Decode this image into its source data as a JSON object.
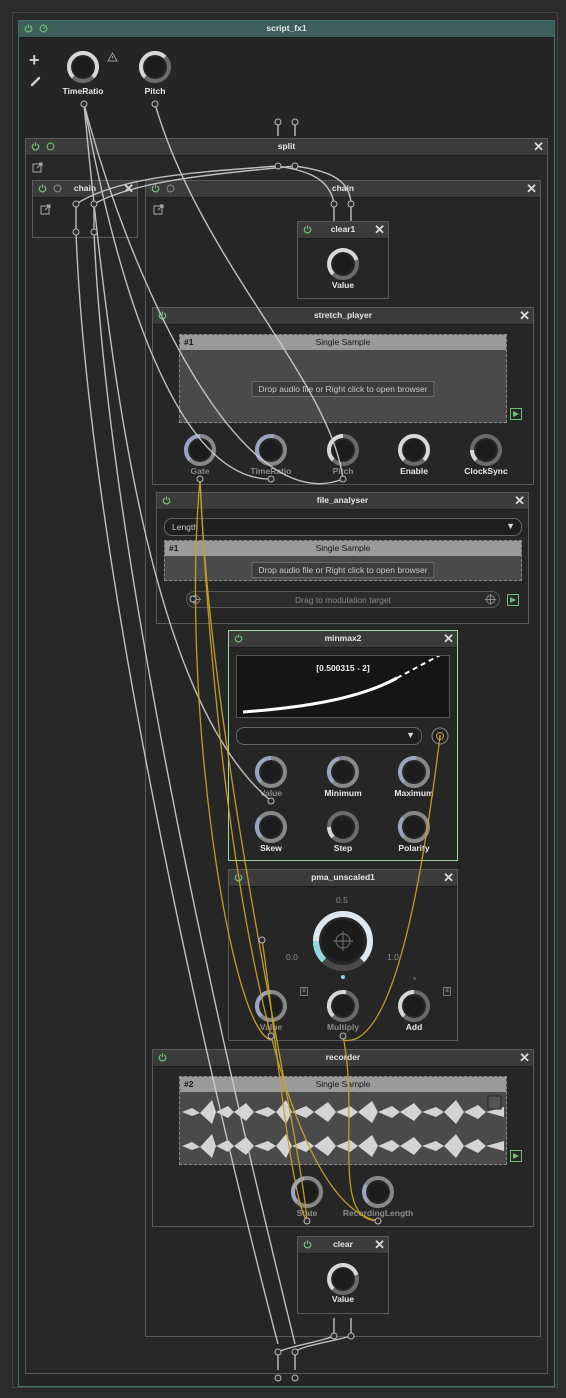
{
  "script_fx": {
    "title": "script_fx1",
    "knobs": [
      {
        "label": "TimeRatio"
      },
      {
        "label": "Pitch"
      }
    ]
  },
  "split": {
    "title": "split"
  },
  "chain_left": {
    "title": "chain"
  },
  "chain_main": {
    "title": "chain"
  },
  "clear1": {
    "title": "clear1",
    "knob_label": "Value"
  },
  "stretch_player": {
    "title": "stretch_player",
    "sample_index": "#1",
    "sample_title": "Single Sample",
    "drop_text": "Drop audio file or Right click to open browser",
    "knobs": [
      {
        "label": "Gate"
      },
      {
        "label": "TimeRatio"
      },
      {
        "label": "Pitch"
      },
      {
        "label": "Enable"
      },
      {
        "label": "ClockSync"
      }
    ]
  },
  "file_analyser": {
    "title": "file_analyser",
    "mode_value": "Length",
    "sample_index": "#1",
    "sample_title": "Single Sample",
    "drop_text": "Drop audio file or Right click to open browser",
    "drag_text": "Drag to modulation target"
  },
  "minmax2": {
    "title": "minmax2",
    "range_text": "[0.500315 - 2]",
    "mode_value": "",
    "knobs": [
      {
        "label": "Value"
      },
      {
        "label": "Minimum"
      },
      {
        "label": "Maximum"
      },
      {
        "label": "Skew"
      },
      {
        "label": "Step"
      },
      {
        "label": "Polarity"
      }
    ]
  },
  "pma": {
    "title": "pma_unscaled1",
    "scale_mid": "0.5",
    "scale_min": "0.0",
    "scale_max": "1.0",
    "knobs": [
      {
        "label": "Value"
      },
      {
        "label": "Multiply"
      },
      {
        "label": "Add"
      }
    ]
  },
  "recorder": {
    "title": "recorder",
    "sample_index": "#2",
    "sample_title": "Single Sample",
    "knobs": [
      {
        "label": "State"
      },
      {
        "label": "RecordingLength"
      }
    ]
  },
  "clear": {
    "title": "clear",
    "knob_label": "Value"
  },
  "colors": {
    "accent_green": "#6fbf73",
    "cable_gold": "#c9a227",
    "cable_white": "#d8d8d8",
    "highlight_border": "#9fd89f"
  }
}
